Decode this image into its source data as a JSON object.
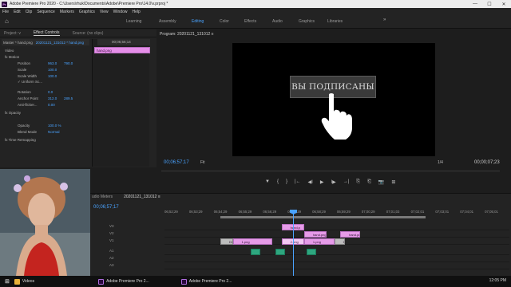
{
  "window": {
    "title": "Adobe Premiere Pro 2020 - C:\\Users\\rhuk\\Documents\\Adobe\\Premiere Pro\\14.0\\v.prproj *",
    "controls": [
      "—",
      "☐",
      "✕"
    ]
  },
  "menu": [
    "File",
    "Edit",
    "Clip",
    "Sequence",
    "Markers",
    "Graphics",
    "View",
    "Window",
    "Help"
  ],
  "workspaces": {
    "tabs": [
      "Learning",
      "Assembly",
      "Editing",
      "Color",
      "Effects",
      "Audio",
      "Graphics",
      "Libraries"
    ],
    "active": "Editing",
    "more": "»"
  },
  "effect_controls": {
    "tabs": [
      "Project: v",
      "Effect Controls",
      "Source: (no clips)"
    ],
    "active_tab": "Effect Controls",
    "master_label": "Master * hand.png",
    "sequence_label": "20201121_131012 * hand.png",
    "timecode": "00;06;56;14",
    "clip_name": "hand.png",
    "section": "Video",
    "rows": [
      {
        "name": "fx Motion",
        "value": "",
        "value2": ""
      },
      {
        "name": "Position",
        "value": "963.0",
        "value2": "790.0"
      },
      {
        "name": "Scale",
        "value": "100.0",
        "value2": ""
      },
      {
        "name": "Scale Width",
        "value": "100.0",
        "value2": ""
      },
      {
        "name": "✓ Uniform Sc...",
        "value": "",
        "value2": ""
      },
      {
        "name": "Rotation",
        "value": "0.0",
        "value2": ""
      },
      {
        "name": "Anchor Point",
        "value": "312.0",
        "value2": "289.5"
      },
      {
        "name": "Anti-flicker...",
        "value": "0.00",
        "value2": ""
      },
      {
        "name": "fx Opacity",
        "value": "",
        "value2": ""
      },
      {
        "name": "",
        "value": "",
        "value2": ""
      },
      {
        "name": "Opacity",
        "value": "100.0 %",
        "value2": ""
      },
      {
        "name": "Blend Mode",
        "value": "Normal",
        "value2": ""
      },
      {
        "name": "fx Time Remapping",
        "value": "",
        "value2": ""
      }
    ]
  },
  "program": {
    "title": "Program: 20201121_131012 ≡",
    "subtitle_text": "ВЫ ПОДПИСАНЫ",
    "timecode": "00;06;57;17",
    "fit": "Fit",
    "fraction": "1/4",
    "duration": "00;00;07;23",
    "controls": [
      "▼",
      "{",
      "}",
      "|←",
      "◀I",
      "▶",
      "I▶",
      "→|",
      "⎘",
      "⎗",
      "📷",
      "⊞"
    ]
  },
  "timeline": {
    "tabs": [
      "udio Meters",
      "20201121_131012 ≡"
    ],
    "active_tab": "20201121_131012 ≡",
    "timecode": "00;06;57;17",
    "ruler": [
      "06;52;29",
      "06;53;29",
      "06;54;29",
      "06;55;29",
      "06;56;29",
      "06;57;29",
      "06;58;29",
      "06;59;29",
      "07;00;29",
      "07;01;03",
      "07;02;01",
      "07;03;01",
      "07;04;01",
      "07;05;01"
    ],
    "tracks": [
      {
        "name": "V3",
        "clips": [
          {
            "label": "hand.p",
            "kind": "pink",
            "start": 0.285,
            "end": 0.39
          }
        ]
      },
      {
        "name": "V2",
        "clips": [
          {
            "label": "hand.png",
            "kind": "pink",
            "start": 0.39,
            "end": 0.495
          },
          {
            "label": "hand.png",
            "kind": "pink",
            "start": 0.558,
            "end": 0.65
          }
        ]
      },
      {
        "name": "V1",
        "clips": [
          {
            "label": "2.png",
            "kind": "light",
            "start": 0.285,
            "end": 0.39
          },
          {
            "label": "Dip to Black",
            "kind": "gray",
            "start": 0.0,
            "end": 0.058
          },
          {
            "label": "1.png",
            "kind": "pink",
            "start": 0.058,
            "end": 0.24
          },
          {
            "label": "1.png",
            "kind": "pink",
            "start": 0.39,
            "end": 0.53
          },
          {
            "label": "Dip to Black",
            "kind": "gray",
            "start": 0.53,
            "end": 0.58
          }
        ]
      },
      {
        "name": "A1",
        "clips": [
          {
            "label": "",
            "kind": "green",
            "start": 0.14,
            "end": 0.16
          },
          {
            "label": "",
            "kind": "green",
            "start": 0.255,
            "end": 0.3
          },
          {
            "label": "",
            "kind": "green",
            "start": 0.4,
            "end": 0.42
          }
        ]
      },
      {
        "name": "A2",
        "clips": []
      },
      {
        "name": "A3",
        "clips": []
      }
    ]
  },
  "taskbar": {
    "items": [
      "Videos",
      "Adobe Premiere Pro 2...",
      "Adobe Premiere Pro 2..."
    ],
    "time": "12:05 PM"
  }
}
